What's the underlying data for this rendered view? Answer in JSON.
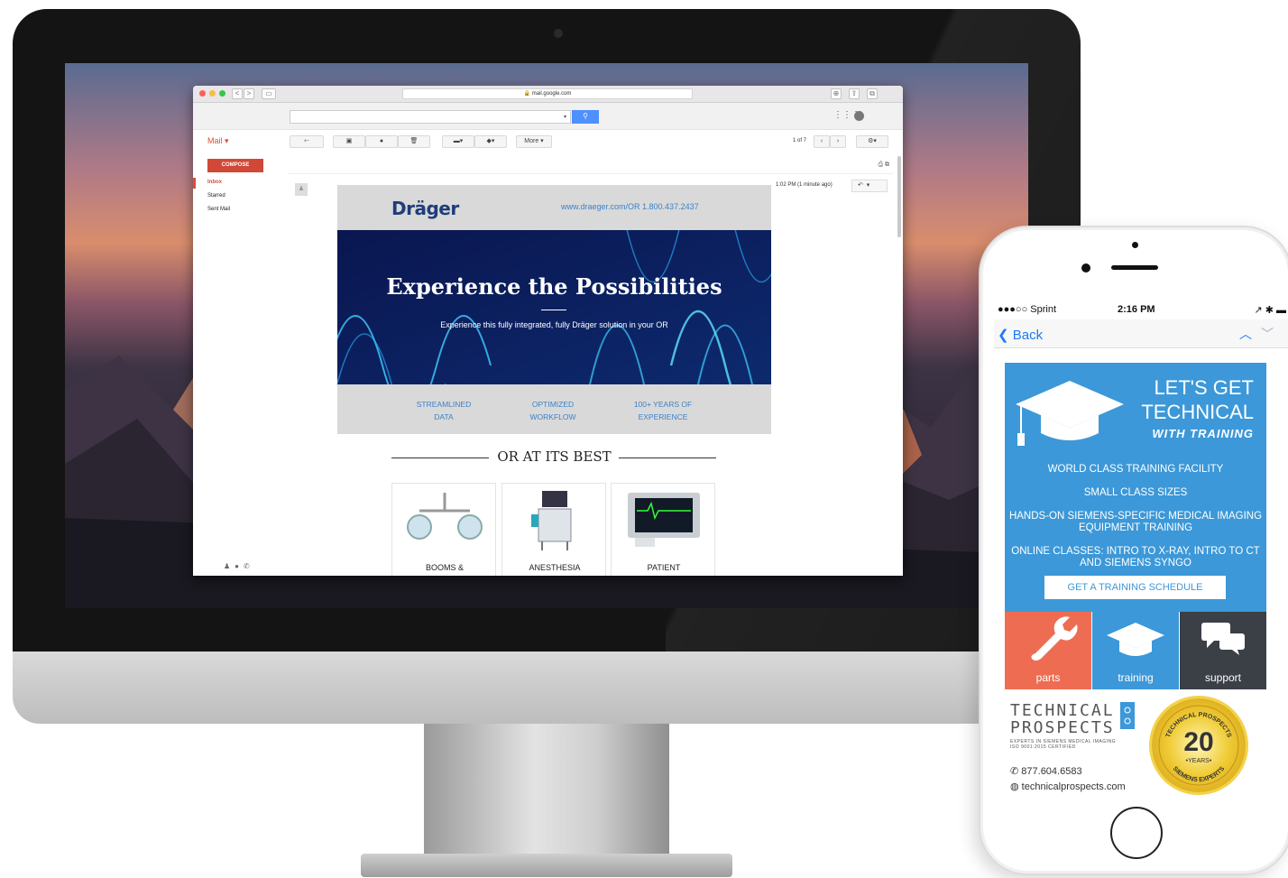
{
  "browser": {
    "url": "mail.google.com",
    "nav_back": "<",
    "nav_forward": ">"
  },
  "gmail": {
    "app_label": "Mail ▾",
    "compose_label": "COMPOSE",
    "nav_items": [
      "Inbox",
      "Starred",
      "Sent Mail"
    ],
    "more_label": "More ▾",
    "pager": "1 of 7",
    "timestamp": "1:02 PM (1 minute ago)"
  },
  "email": {
    "brand": "Dräger",
    "contact": "www.draeger.com/OR   1.800.437.2437",
    "hero_title": "Experience the Possibilities",
    "hero_subtitle": "Experience this fully integrated, fully Dräger solution in your OR",
    "features": [
      {
        "line1": "STREAMLINED",
        "line2": "DATA"
      },
      {
        "line1": "OPTIMIZED",
        "line2": "WORKFLOW"
      },
      {
        "line1": "100+ YEARS OF",
        "line2": "EXPERIENCE"
      }
    ],
    "section_heading": "OR AT ITS BEST",
    "products": [
      "BOOMS &",
      "ANESTHESIA",
      "PATIENT"
    ]
  },
  "phone": {
    "carrier": "●●●○○ Sprint",
    "time": "2:16 PM",
    "back_label": "Back",
    "ad": {
      "headline_line1": "LET'S GET",
      "headline_line2": "TECHNICAL",
      "subheadline": "WITH TRAINING",
      "bullets": [
        "WORLD CLASS TRAINING FACILITY",
        "SMALL CLASS SIZES",
        "HANDS-ON SIEMENS-SPECIFIC MEDICAL IMAGING EQUIPMENT TRAINING",
        "ONLINE CLASSES: INTRO TO X-RAY, INTRO TO CT AND SIEMENS SYNGO"
      ],
      "cta": "GET A TRAINING SCHEDULE",
      "tiles": [
        "parts",
        "training",
        "support"
      ],
      "company_line1": "TECHNICAL",
      "company_line2": "PROSPECTS",
      "tagline": "EXPERTS IN SIEMENS MEDICAL IMAGING",
      "certification": "ISO 9001:2015 CERTIFIED",
      "phone_number": "877.604.6583",
      "website": "technicalprospects.com",
      "seal_number": "20",
      "seal_years": "•YEARS•",
      "seal_top": "TECHNICAL PROSPECTS",
      "seal_bottom": "SIEMENS EXPERTS"
    }
  },
  "colors": {
    "gmail_red": "#d14836",
    "gmail_blue": "#4d90fe",
    "drager_blue": "#1f3d7a",
    "ad_blue": "#3c98d8",
    "parts_tile": "#ee6d52",
    "training_tile": "#3c98d8",
    "support_tile": "#3b3f46"
  }
}
